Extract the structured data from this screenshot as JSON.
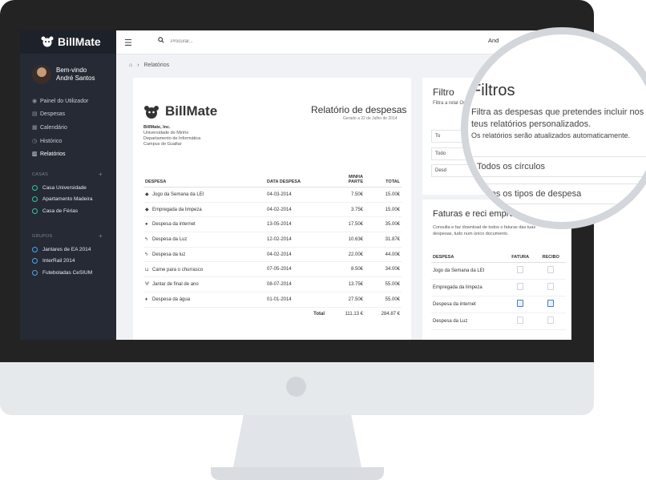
{
  "app": {
    "name": "BillMate"
  },
  "sidebar": {
    "welcome": "Bem-vindo",
    "user": "André Santos",
    "nav": [
      {
        "label": "Painel do Utilizador",
        "icon": "dashboard-icon"
      },
      {
        "label": "Despesas",
        "icon": "receipt-icon"
      },
      {
        "label": "Calendário",
        "icon": "calendar-icon"
      },
      {
        "label": "Histórico",
        "icon": "history-icon"
      },
      {
        "label": "Relatórios",
        "icon": "report-icon"
      }
    ],
    "houses_label": "CASAS",
    "houses": [
      "Casa Universidade",
      "Apartamento Madeira",
      "Casa de Férias"
    ],
    "groups_label": "GRUPOS",
    "groups": [
      "Jantares de EA 2014",
      "InterRail 2014",
      "Futeboladas CeSIUM"
    ]
  },
  "topbar": {
    "search_placeholder": "Procurar...",
    "user_short": "And"
  },
  "breadcrumb": {
    "current": "Relatórios"
  },
  "report": {
    "title": "Relatório de despesas",
    "date": "Gerado a 22 de Julho de 2014",
    "company": "BillMate, Inc.",
    "address": [
      "Universidade do Minho",
      "Departamento de Informática",
      "Campus de Gualtar"
    ],
    "columns": {
      "expense": "DESPESA",
      "date": "DATA DESPESA",
      "share_1": "MINHA",
      "share_2": "PARTE",
      "total": "TOTAL"
    },
    "rows": [
      {
        "icon": "tag-icon",
        "name": "Jogo da Semana da LEI",
        "date": "04-03-2014",
        "share": "7.50€",
        "total": "15.00€"
      },
      {
        "icon": "tag-icon",
        "name": "Empregada da limpeza",
        "date": "04-02-2014",
        "share": "3.75€",
        "total": "15.00€"
      },
      {
        "icon": "globe-icon",
        "name": "Despesa da internet",
        "date": "13-05-2014",
        "share": "17.50€",
        "total": "35.00€"
      },
      {
        "icon": "bolt-icon",
        "name": "Despesa da Luz",
        "date": "12-02-2014",
        "share": "10.63€",
        "total": "31.87€"
      },
      {
        "icon": "bolt-icon",
        "name": "Despesa da luz",
        "date": "04-02-2014",
        "share": "22.00€",
        "total": "44.00€"
      },
      {
        "icon": "cart-icon",
        "name": "Carne para o churrasco",
        "date": "07-05-2014",
        "share": "8.50€",
        "total": "34.00€"
      },
      {
        "icon": "cutlery-icon",
        "name": "Jantar de final de ano",
        "date": "08-07-2014",
        "share": "13.75€",
        "total": "55.00€"
      },
      {
        "icon": "drop-icon",
        "name": "Despesa da água",
        "date": "01-01-2014",
        "share": "27.50€",
        "total": "55.00€"
      }
    ],
    "total_label": "Total",
    "total_share": "111.13 €",
    "total_all": "284.87 €"
  },
  "filters": {
    "title": "Filtros",
    "description": "Filtra as despesas que pretendes incluir nos teus relatórios personalizados.",
    "note": "Os relatórios serão atualizados automaticamente.",
    "circle_select": "Todos os círculos",
    "type_select": "Todos os tipos de despesa",
    "small_title": "Filtro",
    "small_desc": "Filtra a relat Os re",
    "small_sel_1": "To",
    "small_sel_2": "Todo",
    "small_sel_3": "Desd"
  },
  "invoices": {
    "title": "Faturas e reci    empre",
    "description": "Consulta e faz download de todos o faturas das tuas despesas, tudo num único documento.",
    "columns": {
      "expense": "DESPESA",
      "invoice": "FATURA",
      "receipt": "RECIBO"
    },
    "rows": [
      {
        "name": "Jogo da Semana da LEI",
        "invoice_available": false,
        "receipt_available": false
      },
      {
        "name": "Empregada da limpeza",
        "invoice_available": false,
        "receipt_available": false
      },
      {
        "name": "Despesa da internet",
        "invoice_available": true,
        "receipt_available": true
      },
      {
        "name": "Despesa da Luz",
        "invoice_available": false,
        "receipt_available": false
      }
    ]
  },
  "colors": {
    "sidebar": "#252a35",
    "accent_green": "#36c3a4",
    "accent_blue": "#4aa8e6"
  }
}
